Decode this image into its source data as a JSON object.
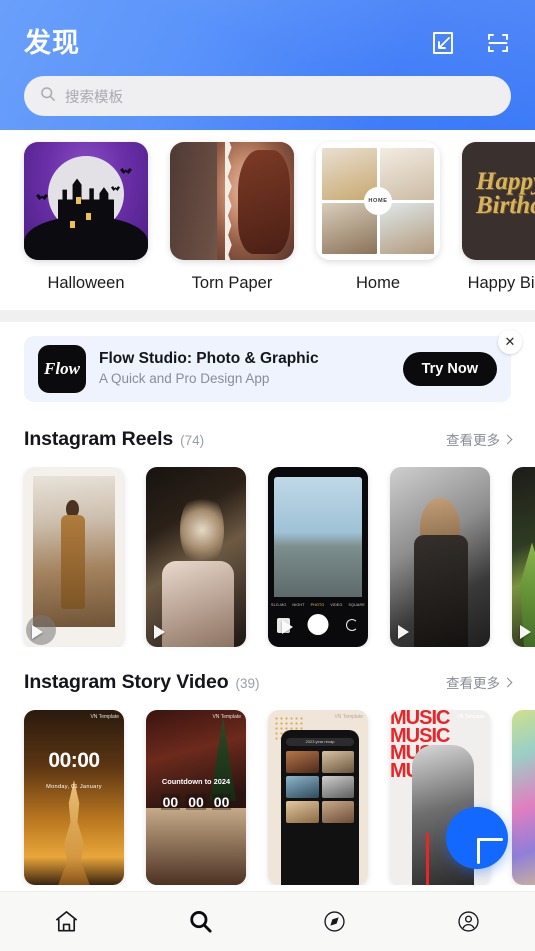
{
  "header": {
    "title": "发现",
    "icons": [
      {
        "name": "import-template-icon",
        "label": "import"
      },
      {
        "name": "scan-icon",
        "label": "scan"
      }
    ],
    "search": {
      "placeholder": "搜索模板",
      "value": "",
      "icon": "search-icon"
    }
  },
  "categories": [
    {
      "label": "Halloween",
      "art": "halloween"
    },
    {
      "label": "Torn Paper",
      "art": "torn-paper"
    },
    {
      "label": "Home",
      "art": "home",
      "badge": "HOME"
    },
    {
      "label": "Happy Birthday",
      "art": "happy-birthday",
      "art_text_line1": "Happy",
      "art_text_line2": "Birthday"
    }
  ],
  "ad": {
    "logo_text": "Flow",
    "title": "Flow Studio: Photo & Graphic",
    "subtitle": "A Quick and Pro Design App",
    "cta": "Try Now",
    "close_icon": "close-icon",
    "close_label": "✕",
    "bg_color": "#eef3fd"
  },
  "sections": [
    {
      "title": "Instagram Reels",
      "count": "(74)",
      "more_label": "查看更多",
      "items": [
        {
          "art": "r1",
          "play": true,
          "play_disc": true
        },
        {
          "art": "r2",
          "play": true,
          "play_disc": false
        },
        {
          "art": "r3",
          "play": true,
          "play_disc": false,
          "modes": [
            "SLO-MO",
            "NIGHT",
            "PHOTO",
            "VIDEO",
            "SQUARE"
          ],
          "active_mode": "PHOTO"
        },
        {
          "art": "r4",
          "play": true,
          "play_disc": false
        },
        {
          "art": "r5",
          "play": true,
          "play_disc": false
        }
      ]
    },
    {
      "title": "Instagram Story Video",
      "count": "(39)",
      "more_label": "查看更多",
      "items": [
        {
          "art": "s1",
          "watermark": "VN Template",
          "clock": "00:00",
          "date": "Monday, 01 January"
        },
        {
          "art": "s2",
          "watermark": "VN Template",
          "countdown_label": "Countdown to 2024",
          "countdown": [
            "00",
            "00",
            "00"
          ]
        },
        {
          "art": "s3",
          "watermark": "VN Template",
          "search_text": "2023 year recap"
        },
        {
          "art": "s4",
          "watermark": "VN Template",
          "marquee": "MUSIC MUSIC MUSIC MUSIC"
        },
        {
          "art": "s5"
        }
      ]
    }
  ],
  "fab": {
    "name": "create-button",
    "icon": "plus-icon"
  },
  "tabbar": {
    "items": [
      {
        "name": "tab-home",
        "icon": "home-icon",
        "active": false
      },
      {
        "name": "tab-search",
        "icon": "search-icon",
        "active": true
      },
      {
        "name": "tab-discover",
        "icon": "compass-icon",
        "active": false
      },
      {
        "name": "tab-profile",
        "icon": "user-icon",
        "active": false
      }
    ]
  },
  "colors": {
    "header_gradient_start": "#6aa0fb",
    "header_gradient_end": "#3b79f7",
    "accent_blue": "#1268ff",
    "ad_bg": "#eef3fd",
    "divider": "#f0f0f1",
    "tabbar_bg": "#f8f8f6"
  }
}
